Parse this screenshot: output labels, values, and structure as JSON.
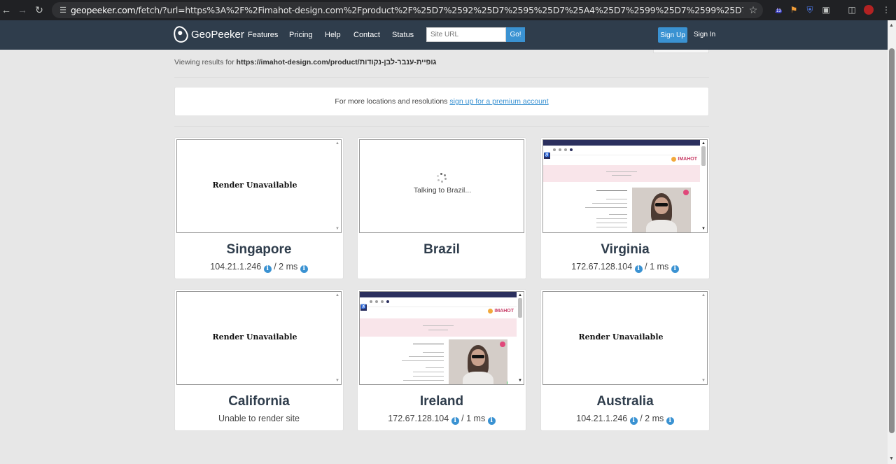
{
  "browser": {
    "url_domain": "geopeeker.com",
    "url_rest": "/fetch/?url=https%3A%2F%2Fimahot-design.com%2Fproduct%2F%25D7%2592%25D7%2595%25D7%25A4%25D7%2599%25D7%2599%25D7%25AA-%25D7%25A2%25D7%25A0%25D7%2591%25D7%25A8-%25D7...",
    "extension_badge": "13"
  },
  "header": {
    "logo_text": "GeoPeeker",
    "nav": [
      "Features",
      "Pricing",
      "Help",
      "Contact",
      "Status"
    ],
    "search_placeholder": "Site URL",
    "go_label": "Go!",
    "signup_label": "Sign Up",
    "signin_label": "Sign In"
  },
  "viewing": {
    "prefix": "Viewing results for",
    "url": "https://imahot-design.com/product/גופיית-ענבר-לבן-נקודות"
  },
  "premium": {
    "text": "For more locations and resolutions",
    "link": "sign up for a premium account"
  },
  "results": [
    {
      "location": "Singapore",
      "status": "render_unavailable",
      "ip": "104.21.1.246",
      "latency": "/ 2 ms"
    },
    {
      "location": "Brazil",
      "status": "loading",
      "loading_text": "Talking to Brazil..."
    },
    {
      "location": "Virginia",
      "status": "rendered",
      "ip": "172.67.128.104",
      "latency": "/ 1 ms"
    },
    {
      "location": "California",
      "status": "render_unavailable",
      "message": "Unable to render site"
    },
    {
      "location": "Ireland",
      "status": "rendered",
      "ip": "172.67.128.104",
      "latency": "/ 1 ms"
    },
    {
      "location": "Australia",
      "status": "render_unavailable",
      "ip": "104.21.1.246",
      "latency": "/ 2 ms"
    }
  ],
  "render_unavailable_text": "Render Unavailable",
  "preview": {
    "brand": "IMAHOT"
  },
  "colors": {
    "header_bg": "#2f3d4c",
    "accent": "#3a92d2",
    "page_bg": "#e7e7e7"
  }
}
